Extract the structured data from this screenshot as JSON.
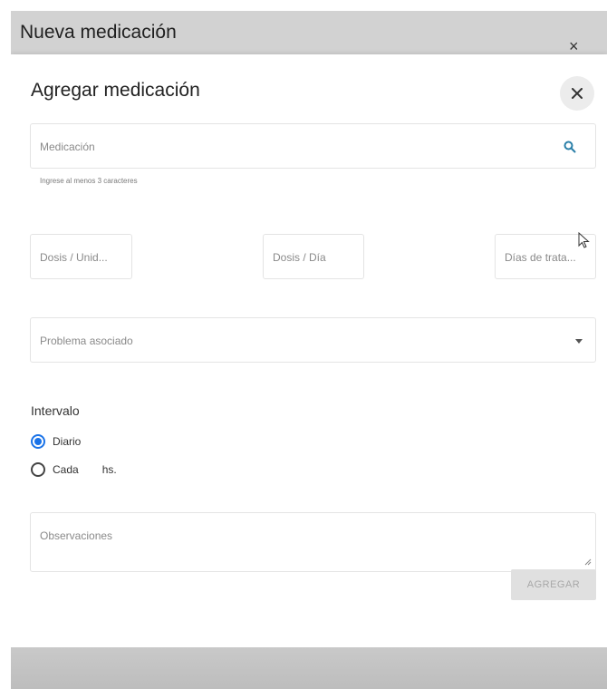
{
  "background_dialog": {
    "title": "Nueva medicación",
    "close_glyph": "×"
  },
  "dialog": {
    "title": "Agregar medicación",
    "close_glyph": "×"
  },
  "medication": {
    "placeholder": "Medicación",
    "hint": "Ingrese al menos 3 caracteres",
    "icon": "search-icon"
  },
  "dose_fields": [
    {
      "placeholder": "Dosis / Unid..."
    },
    {
      "placeholder": "Dosis / Día"
    },
    {
      "placeholder": "Días de trata..."
    }
  ],
  "problem": {
    "placeholder": "Problema asociado",
    "icon": "caret-down-icon"
  },
  "interval": {
    "label": "Intervalo",
    "options": [
      {
        "label": "Diario",
        "checked": true
      },
      {
        "label": "Cada",
        "suffix": "hs.",
        "checked": false
      }
    ]
  },
  "observations": {
    "placeholder": "Observaciones"
  },
  "submit": {
    "label": "AGREGAR",
    "enabled": false
  },
  "colors": {
    "accent": "#1a73e8",
    "search_icon": "#2a7fa8"
  }
}
